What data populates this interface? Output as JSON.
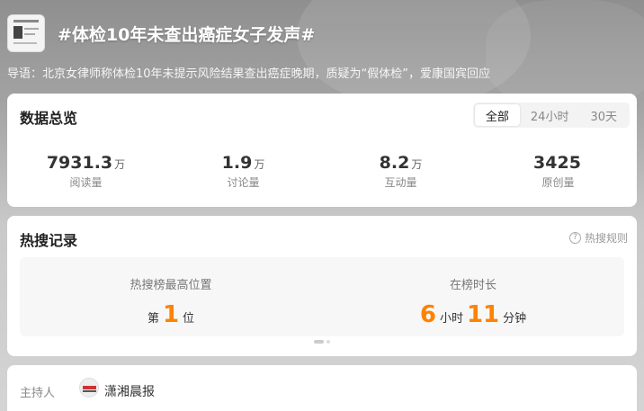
{
  "topic": {
    "title": "#体检10年未查出癌症女子发声#",
    "intro": "导语：北京女律师称体检10年未提示风险结果查出癌症晚期，质疑为“假体检”，爱康国宾回应"
  },
  "overview": {
    "title": "数据总览",
    "tabs": [
      "全部",
      "24小时",
      "30天"
    ],
    "active_tab": "全部",
    "stats": [
      {
        "value": "7931.3",
        "unit": "万",
        "label": "阅读量"
      },
      {
        "value": "1.9",
        "unit": "万",
        "label": "讨论量"
      },
      {
        "value": "8.2",
        "unit": "万",
        "label": "互动量"
      },
      {
        "value": "3425",
        "unit": "",
        "label": "原创量"
      }
    ]
  },
  "hot_record": {
    "title": "热搜记录",
    "rules_link": "热搜规则",
    "rank_label": "热搜榜最高位置",
    "rank_prefix": "第",
    "rank_value": "1",
    "rank_suffix": "位",
    "duration_label": "在榜时长",
    "duration_hours": "6",
    "duration_hours_unit": "小时",
    "duration_minutes": "11",
    "duration_minutes_unit": "分钟"
  },
  "host": {
    "label": "主持人",
    "name": "潇湘晨报"
  },
  "colors": {
    "accent_orange": "#ff8200",
    "card_bg": "#ffffff"
  }
}
